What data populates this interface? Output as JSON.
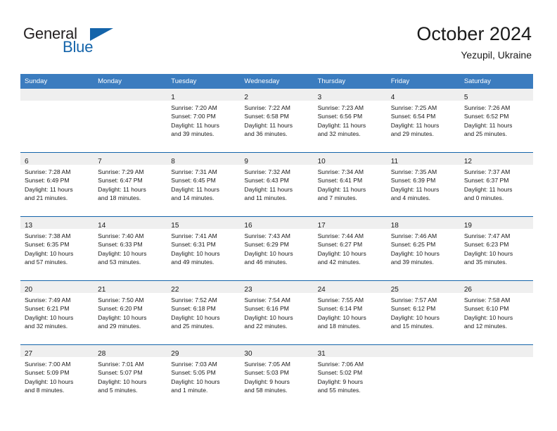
{
  "brand": {
    "word_one": "General",
    "word_two": "Blue",
    "flag_icon": "triangle-flag-icon"
  },
  "header": {
    "title": "October 2024",
    "subtitle": "Yezupil, Ukraine"
  },
  "colors": {
    "header_blue": "#3b7cbf",
    "divider_blue": "#1464aa",
    "daynum_band": "#efefef",
    "brand_blue": "#1464aa",
    "text": "#1a1a1a"
  },
  "calendar": {
    "weekday_headers": [
      "Sunday",
      "Monday",
      "Tuesday",
      "Wednesday",
      "Thursday",
      "Friday",
      "Saturday"
    ],
    "weeks": [
      [
        {
          "day": "",
          "sunrise": "",
          "sunset": "",
          "daylight_line1": "",
          "daylight_line2": ""
        },
        {
          "day": "",
          "sunrise": "",
          "sunset": "",
          "daylight_line1": "",
          "daylight_line2": ""
        },
        {
          "day": "1",
          "sunrise": "Sunrise: 7:20 AM",
          "sunset": "Sunset: 7:00 PM",
          "daylight_line1": "Daylight: 11 hours",
          "daylight_line2": "and 39 minutes."
        },
        {
          "day": "2",
          "sunrise": "Sunrise: 7:22 AM",
          "sunset": "Sunset: 6:58 PM",
          "daylight_line1": "Daylight: 11 hours",
          "daylight_line2": "and 36 minutes."
        },
        {
          "day": "3",
          "sunrise": "Sunrise: 7:23 AM",
          "sunset": "Sunset: 6:56 PM",
          "daylight_line1": "Daylight: 11 hours",
          "daylight_line2": "and 32 minutes."
        },
        {
          "day": "4",
          "sunrise": "Sunrise: 7:25 AM",
          "sunset": "Sunset: 6:54 PM",
          "daylight_line1": "Daylight: 11 hours",
          "daylight_line2": "and 29 minutes."
        },
        {
          "day": "5",
          "sunrise": "Sunrise: 7:26 AM",
          "sunset": "Sunset: 6:52 PM",
          "daylight_line1": "Daylight: 11 hours",
          "daylight_line2": "and 25 minutes."
        }
      ],
      [
        {
          "day": "6",
          "sunrise": "Sunrise: 7:28 AM",
          "sunset": "Sunset: 6:49 PM",
          "daylight_line1": "Daylight: 11 hours",
          "daylight_line2": "and 21 minutes."
        },
        {
          "day": "7",
          "sunrise": "Sunrise: 7:29 AM",
          "sunset": "Sunset: 6:47 PM",
          "daylight_line1": "Daylight: 11 hours",
          "daylight_line2": "and 18 minutes."
        },
        {
          "day": "8",
          "sunrise": "Sunrise: 7:31 AM",
          "sunset": "Sunset: 6:45 PM",
          "daylight_line1": "Daylight: 11 hours",
          "daylight_line2": "and 14 minutes."
        },
        {
          "day": "9",
          "sunrise": "Sunrise: 7:32 AM",
          "sunset": "Sunset: 6:43 PM",
          "daylight_line1": "Daylight: 11 hours",
          "daylight_line2": "and 11 minutes."
        },
        {
          "day": "10",
          "sunrise": "Sunrise: 7:34 AM",
          "sunset": "Sunset: 6:41 PM",
          "daylight_line1": "Daylight: 11 hours",
          "daylight_line2": "and 7 minutes."
        },
        {
          "day": "11",
          "sunrise": "Sunrise: 7:35 AM",
          "sunset": "Sunset: 6:39 PM",
          "daylight_line1": "Daylight: 11 hours",
          "daylight_line2": "and 4 minutes."
        },
        {
          "day": "12",
          "sunrise": "Sunrise: 7:37 AM",
          "sunset": "Sunset: 6:37 PM",
          "daylight_line1": "Daylight: 11 hours",
          "daylight_line2": "and 0 minutes."
        }
      ],
      [
        {
          "day": "13",
          "sunrise": "Sunrise: 7:38 AM",
          "sunset": "Sunset: 6:35 PM",
          "daylight_line1": "Daylight: 10 hours",
          "daylight_line2": "and 57 minutes."
        },
        {
          "day": "14",
          "sunrise": "Sunrise: 7:40 AM",
          "sunset": "Sunset: 6:33 PM",
          "daylight_line1": "Daylight: 10 hours",
          "daylight_line2": "and 53 minutes."
        },
        {
          "day": "15",
          "sunrise": "Sunrise: 7:41 AM",
          "sunset": "Sunset: 6:31 PM",
          "daylight_line1": "Daylight: 10 hours",
          "daylight_line2": "and 49 minutes."
        },
        {
          "day": "16",
          "sunrise": "Sunrise: 7:43 AM",
          "sunset": "Sunset: 6:29 PM",
          "daylight_line1": "Daylight: 10 hours",
          "daylight_line2": "and 46 minutes."
        },
        {
          "day": "17",
          "sunrise": "Sunrise: 7:44 AM",
          "sunset": "Sunset: 6:27 PM",
          "daylight_line1": "Daylight: 10 hours",
          "daylight_line2": "and 42 minutes."
        },
        {
          "day": "18",
          "sunrise": "Sunrise: 7:46 AM",
          "sunset": "Sunset: 6:25 PM",
          "daylight_line1": "Daylight: 10 hours",
          "daylight_line2": "and 39 minutes."
        },
        {
          "day": "19",
          "sunrise": "Sunrise: 7:47 AM",
          "sunset": "Sunset: 6:23 PM",
          "daylight_line1": "Daylight: 10 hours",
          "daylight_line2": "and 35 minutes."
        }
      ],
      [
        {
          "day": "20",
          "sunrise": "Sunrise: 7:49 AM",
          "sunset": "Sunset: 6:21 PM",
          "daylight_line1": "Daylight: 10 hours",
          "daylight_line2": "and 32 minutes."
        },
        {
          "day": "21",
          "sunrise": "Sunrise: 7:50 AM",
          "sunset": "Sunset: 6:20 PM",
          "daylight_line1": "Daylight: 10 hours",
          "daylight_line2": "and 29 minutes."
        },
        {
          "day": "22",
          "sunrise": "Sunrise: 7:52 AM",
          "sunset": "Sunset: 6:18 PM",
          "daylight_line1": "Daylight: 10 hours",
          "daylight_line2": "and 25 minutes."
        },
        {
          "day": "23",
          "sunrise": "Sunrise: 7:54 AM",
          "sunset": "Sunset: 6:16 PM",
          "daylight_line1": "Daylight: 10 hours",
          "daylight_line2": "and 22 minutes."
        },
        {
          "day": "24",
          "sunrise": "Sunrise: 7:55 AM",
          "sunset": "Sunset: 6:14 PM",
          "daylight_line1": "Daylight: 10 hours",
          "daylight_line2": "and 18 minutes."
        },
        {
          "day": "25",
          "sunrise": "Sunrise: 7:57 AM",
          "sunset": "Sunset: 6:12 PM",
          "daylight_line1": "Daylight: 10 hours",
          "daylight_line2": "and 15 minutes."
        },
        {
          "day": "26",
          "sunrise": "Sunrise: 7:58 AM",
          "sunset": "Sunset: 6:10 PM",
          "daylight_line1": "Daylight: 10 hours",
          "daylight_line2": "and 12 minutes."
        }
      ],
      [
        {
          "day": "27",
          "sunrise": "Sunrise: 7:00 AM",
          "sunset": "Sunset: 5:09 PM",
          "daylight_line1": "Daylight: 10 hours",
          "daylight_line2": "and 8 minutes."
        },
        {
          "day": "28",
          "sunrise": "Sunrise: 7:01 AM",
          "sunset": "Sunset: 5:07 PM",
          "daylight_line1": "Daylight: 10 hours",
          "daylight_line2": "and 5 minutes."
        },
        {
          "day": "29",
          "sunrise": "Sunrise: 7:03 AM",
          "sunset": "Sunset: 5:05 PM",
          "daylight_line1": "Daylight: 10 hours",
          "daylight_line2": "and 1 minute."
        },
        {
          "day": "30",
          "sunrise": "Sunrise: 7:05 AM",
          "sunset": "Sunset: 5:03 PM",
          "daylight_line1": "Daylight: 9 hours",
          "daylight_line2": "and 58 minutes."
        },
        {
          "day": "31",
          "sunrise": "Sunrise: 7:06 AM",
          "sunset": "Sunset: 5:02 PM",
          "daylight_line1": "Daylight: 9 hours",
          "daylight_line2": "and 55 minutes."
        },
        {
          "day": "",
          "sunrise": "",
          "sunset": "",
          "daylight_line1": "",
          "daylight_line2": ""
        },
        {
          "day": "",
          "sunrise": "",
          "sunset": "",
          "daylight_line1": "",
          "daylight_line2": ""
        }
      ]
    ]
  }
}
